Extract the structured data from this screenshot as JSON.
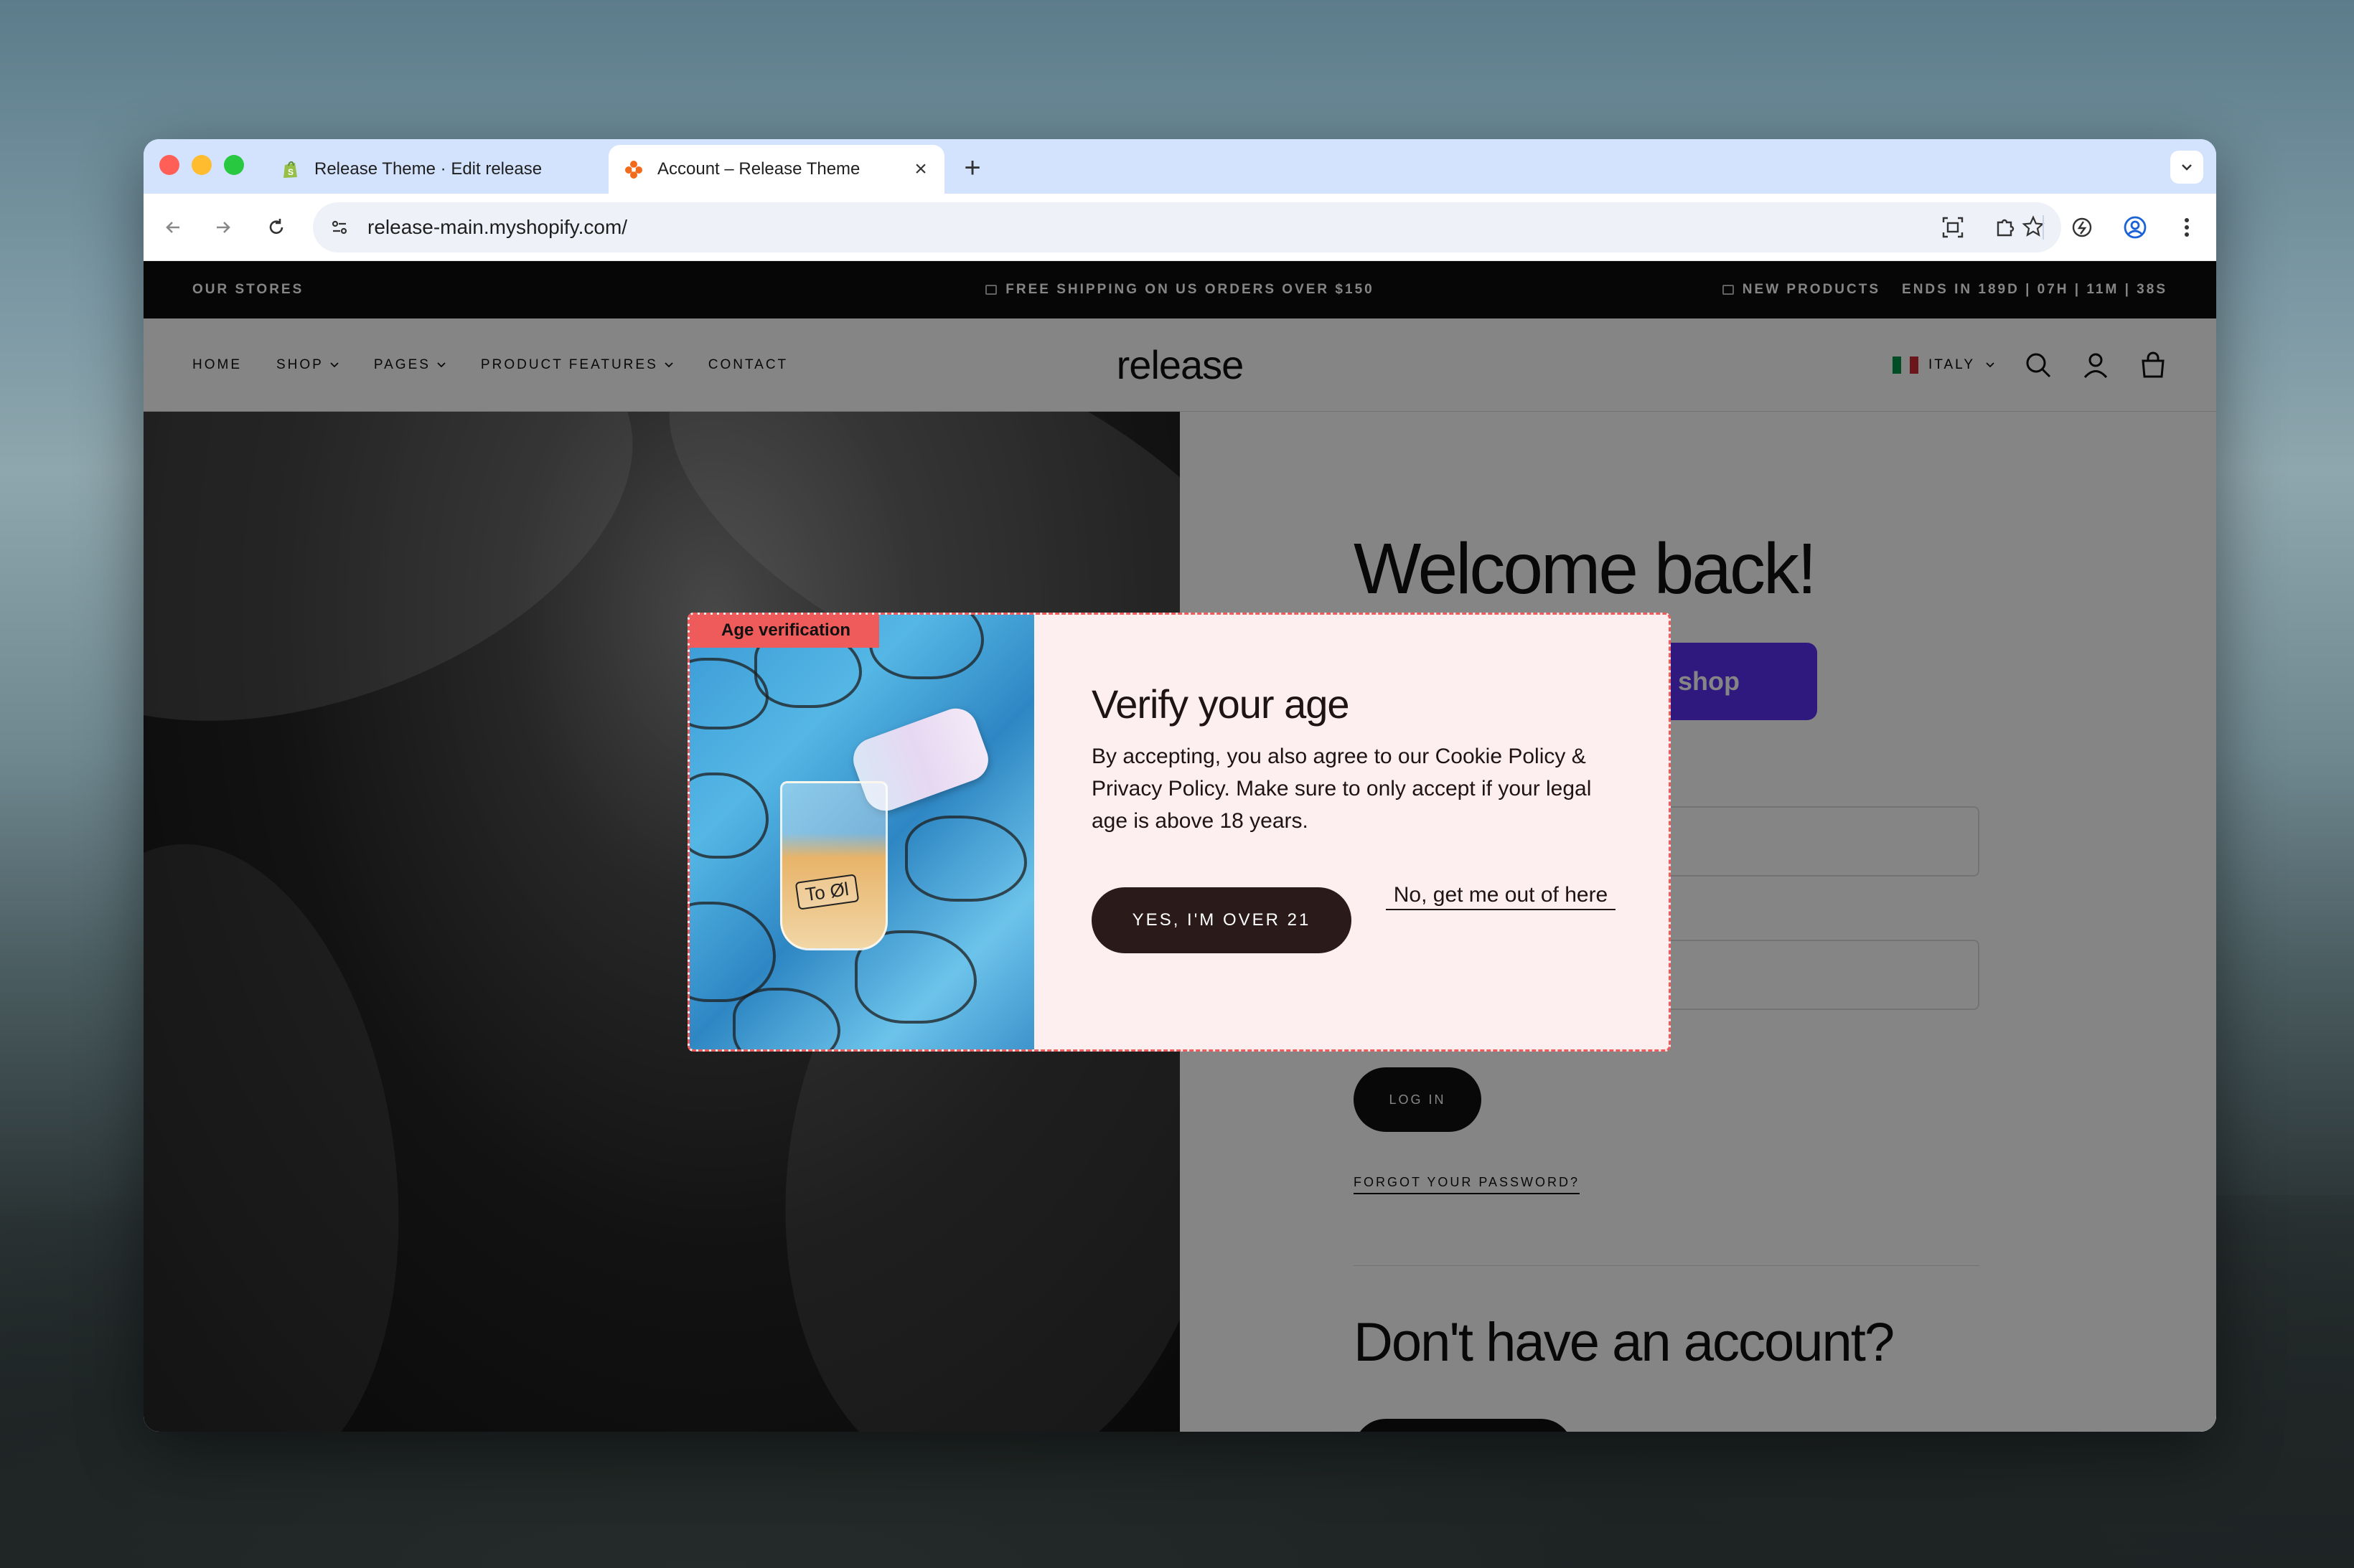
{
  "browser": {
    "tabs": [
      {
        "title": "Release Theme · Edit release",
        "active": false
      },
      {
        "title": "Account – Release Theme",
        "active": true
      }
    ],
    "url": "release-main.myshopify.com/"
  },
  "announcement": {
    "left": "OUR STORES",
    "center": "FREE SHIPPING ON US ORDERS OVER $150",
    "right_link": "NEW PRODUCTS",
    "countdown": "ENDS IN 189D | 07H | 11M | 38S"
  },
  "header": {
    "nav": [
      "HOME",
      "SHOP",
      "PAGES",
      "PRODUCT FEATURES",
      "CONTACT"
    ],
    "logo": "release",
    "country": "ITALY"
  },
  "account": {
    "welcome": "Welcome back!",
    "shop_button": "th shop",
    "login_button": "LOG IN",
    "forgot": "FORGOT YOUR PASSWORD?",
    "no_account": "Don't have an account?"
  },
  "modal": {
    "badge": "Age verification",
    "image_label": "To Øl",
    "title": "Verify your age",
    "body": "By accepting, you also agree to our Cookie Policy & Privacy Policy. Make sure to only accept if your legal age is above 18 years.",
    "accept": "YES, I'M OVER 21",
    "decline": "No, get me out of here"
  },
  "colors": {
    "accent_red": "#ef5a5a",
    "modal_bg": "#fdeef0",
    "shop_purple": "#5a31f4"
  }
}
